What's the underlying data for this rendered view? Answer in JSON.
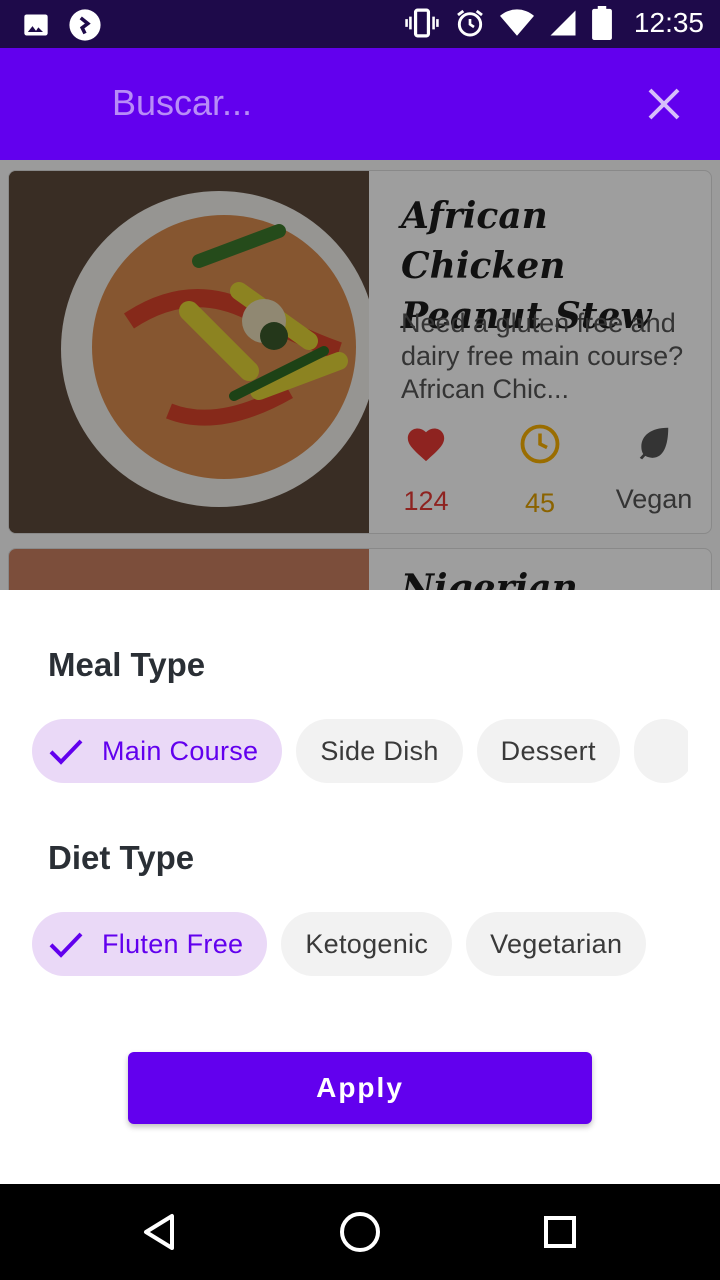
{
  "status_bar": {
    "time": "12:35",
    "icons": [
      "image-icon",
      "notification-icon",
      "vibrate-icon",
      "alarm-icon",
      "wifi-icon",
      "signal-icon",
      "battery-icon"
    ]
  },
  "toolbar": {
    "search_placeholder": "Buscar...",
    "close_icon": "close-icon"
  },
  "recipes": [
    {
      "title": "African Chicken Peanut Stew",
      "description": "Need a gluten free and dairy free main course? African Chic...",
      "likes": "124",
      "minutes": "45",
      "diet": "Vegan"
    },
    {
      "title": "Nigerian Snail"
    }
  ],
  "filter_sheet": {
    "meal_type": {
      "title": "Meal Type",
      "chips": [
        "Main Course",
        "Side Dish",
        "Dessert"
      ],
      "selected": "Main Course"
    },
    "diet_type": {
      "title": "Diet Type",
      "chips": [
        "Fluten Free",
        "Ketogenic",
        "Vegetarian"
      ],
      "selected": "Fluten Free"
    },
    "apply_label": "Apply"
  },
  "colors": {
    "primary": "#6200ee",
    "status_bar": "#1e0a4a",
    "chip_selected_bg": "#ead9f7",
    "heart": "#e53935",
    "clock": "#f9b000",
    "leaf": "#555555"
  },
  "nav_bar": {
    "icons": [
      "back-icon",
      "home-icon",
      "recents-icon"
    ]
  }
}
